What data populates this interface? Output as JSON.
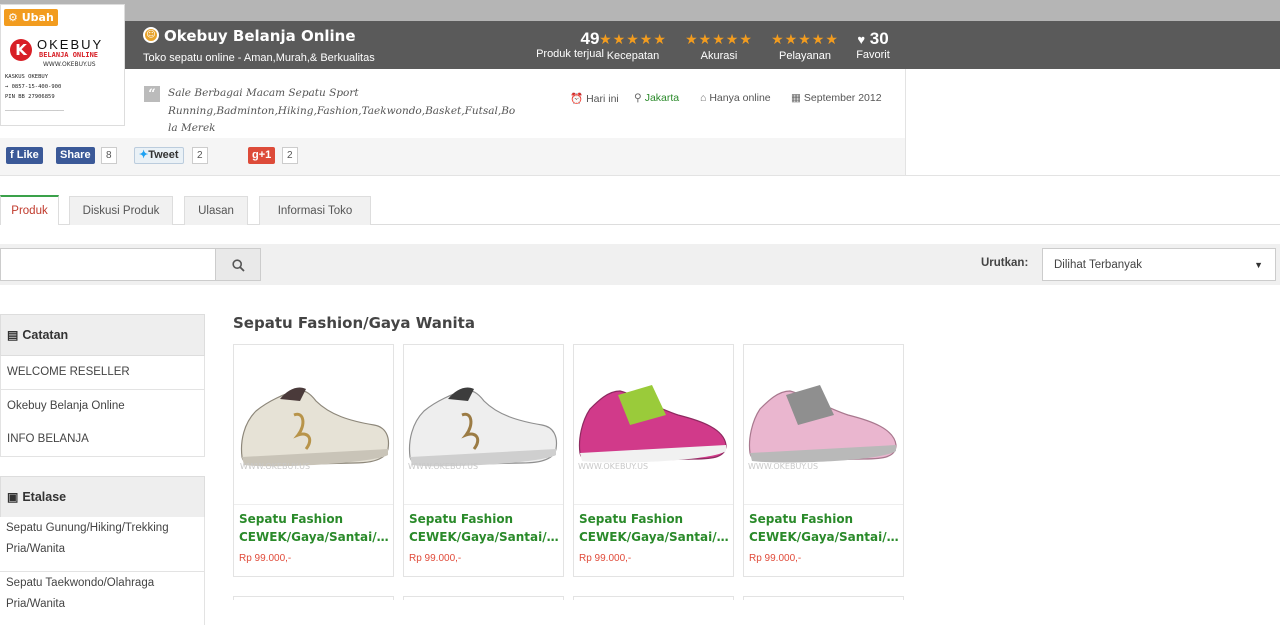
{
  "logo": {
    "edit_label": "Ubah",
    "brand": "OKEBUY",
    "brand_sub": "BELANJA ONLINE",
    "url": "WWW.OKEBUY.US",
    "info_lines": [
      "KASKUS       OKEBUY",
      "  →      0857-15-400-900",
      "PIN BB       27906859"
    ]
  },
  "store": {
    "name": "Okebuy Belanja Online",
    "tagline": "Toko sepatu online - Aman,Murah,& Berkualitas",
    "description": "Sale Berbagai Macam Sepatu Sport Running,Badminton,Hiking,Fashion,Taekwondo,Basket,Futsal,Bola Merek",
    "desc_lines": [
      "Sale Berbagai Macam Sepatu Sport",
      "Running,Badminton,Hiking,Fashion,Taekwondo,Basket,Futsal,Bo",
      "la Merek"
    ],
    "last_online": "Hari ini",
    "location": "Jakarta",
    "store_type": "Hanya online",
    "since": "September 2012"
  },
  "stats": {
    "sold_count": "49",
    "sold_label": "Produk terjual",
    "speed_label": "Kecepatan",
    "accuracy_label": "Akurasi",
    "service_label": "Pelayanan",
    "favorite_count": "30",
    "favorite_label": "Favorit",
    "stars": "★★★★★",
    "speed_rating": 5,
    "accuracy_rating": 5,
    "service_rating": 5
  },
  "social": {
    "like_label": "Like",
    "share_label": "Share",
    "share_count": "8",
    "tweet_label": "Tweet",
    "tweet_count": "2",
    "gplus_label": "+1",
    "gplus_count": "2"
  },
  "tabs": [
    "Produk",
    "Diskusi Produk",
    "Ulasan",
    "Informasi Toko"
  ],
  "search": {
    "placeholder": ""
  },
  "sort": {
    "label": "Urutkan:",
    "selected": "Dilihat Terbanyak"
  },
  "sidebar": {
    "notes_title": "Catatan",
    "notes": [
      "WELCOME RESELLER",
      "Okebuy Belanja Online",
      "INFO BELANJA"
    ],
    "showcase_title": "Etalase",
    "showcase": [
      {
        "line1": "Sepatu Gunung/Hiking/Trekking",
        "line2": "Pria/Wanita"
      },
      {
        "line1": "Sepatu Taekwondo/Olahraga",
        "line2": "Pria/Wanita"
      }
    ]
  },
  "section": {
    "title": "Sepatu Fashion/Gaya Wanita"
  },
  "products": [
    {
      "line1": "Sepatu Fashion",
      "line2": "CEWEK/Gaya/Santai/Ja...",
      "price": "Rp 99.000,-",
      "watermark": "WWW.OKEBUY.US"
    },
    {
      "line1": "Sepatu Fashion",
      "line2": "CEWEK/Gaya/Santai/Ja...",
      "price": "Rp 99.000,-",
      "watermark": "WWW.OKEBUY.US"
    },
    {
      "line1": "Sepatu Fashion",
      "line2": "CEWEK/Gaya/Santai/Ja...",
      "price": "Rp 99.000,-",
      "watermark": "WWW.OKEBUY.US"
    },
    {
      "line1": "Sepatu Fashion",
      "line2": "CEWEK/Gaya/Santai/Ja...",
      "price": "Rp 99.000,-",
      "watermark": "WWW.OKEBUY.US"
    }
  ],
  "colors": {
    "header_bg": "#5a5a5a",
    "star": "#f29c1f",
    "product_name": "#2a8a2a",
    "price": "#e04b3a",
    "active_tab_text": "#c0392b",
    "active_tab_border": "#3aa14a"
  }
}
